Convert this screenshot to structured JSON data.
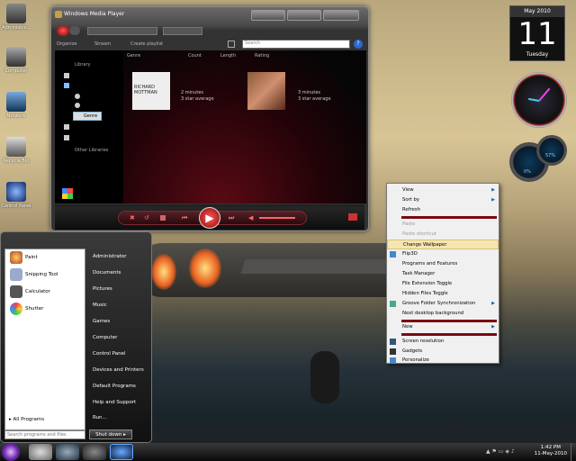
{
  "desktop": {
    "icons": [
      {
        "label": "Administra..."
      },
      {
        "label": "Computer"
      },
      {
        "label": "Network"
      },
      {
        "label": "Recycle Bin"
      },
      {
        "label": "Control Panel"
      }
    ]
  },
  "wmp": {
    "title": "Windows Media Player",
    "menu": {
      "organize": "Organize",
      "stream": "Stream",
      "create_playlist": "Create playlist"
    },
    "search_placeholder": "Search",
    "library": {
      "library": "Library",
      "genre": "Genre",
      "other_libraries": "Other Libraries"
    },
    "columns": {
      "genre": "Genre",
      "count": "Count",
      "length": "Length",
      "rating": "Rating"
    },
    "albums": [
      {
        "cover_text": "RICHARD MOTTMAN",
        "length": "2 minutes",
        "rating": "3 star average"
      },
      {
        "length": "3 minutes",
        "rating": "3 star average"
      }
    ]
  },
  "gadgets": {
    "calendar": {
      "month": "May 2010",
      "day": "11",
      "weekday": "Tuesday"
    },
    "meter1": "0%",
    "meter2": "57%"
  },
  "context_menu": {
    "items": [
      {
        "label": "View",
        "submenu": true
      },
      {
        "label": "Sort by",
        "submenu": true
      },
      {
        "label": "Refresh"
      },
      {
        "label": "Paste",
        "disabled": true
      },
      {
        "label": "Paste shortcut",
        "disabled": true
      },
      {
        "label": "Change Wallpaper",
        "highlight": true
      },
      {
        "label": "Flip3D"
      },
      {
        "label": "Programs and Features"
      },
      {
        "label": "Task Manager"
      },
      {
        "label": "File Extension Toggle"
      },
      {
        "label": "Hidden Files Toggle"
      },
      {
        "label": "Groove Folder Synchronization",
        "submenu": true
      },
      {
        "label": "Next desktop background"
      },
      {
        "label": "New",
        "submenu": true
      },
      {
        "label": "Screen resolution"
      },
      {
        "label": "Gadgets"
      },
      {
        "label": "Personalize"
      }
    ]
  },
  "start_menu": {
    "programs": [
      {
        "label": "Paint"
      },
      {
        "label": "Snipping Tool"
      },
      {
        "label": "Calculator"
      },
      {
        "label": "Shutter"
      }
    ],
    "all_programs": "All Programs",
    "search_placeholder": "Search programs and files",
    "shutdown": "Shut down",
    "right": [
      {
        "label": "Administrator"
      },
      {
        "label": "Documents"
      },
      {
        "label": "Pictures"
      },
      {
        "label": "Music"
      },
      {
        "label": "Games"
      },
      {
        "label": "Computer"
      },
      {
        "label": "Control Panel"
      },
      {
        "label": "Devices and Printers"
      },
      {
        "label": "Default Programs"
      },
      {
        "label": "Help and Support"
      },
      {
        "label": "Run..."
      }
    ]
  },
  "taskbar": {
    "time": "1:42 PM",
    "date": "11-May-2010"
  }
}
